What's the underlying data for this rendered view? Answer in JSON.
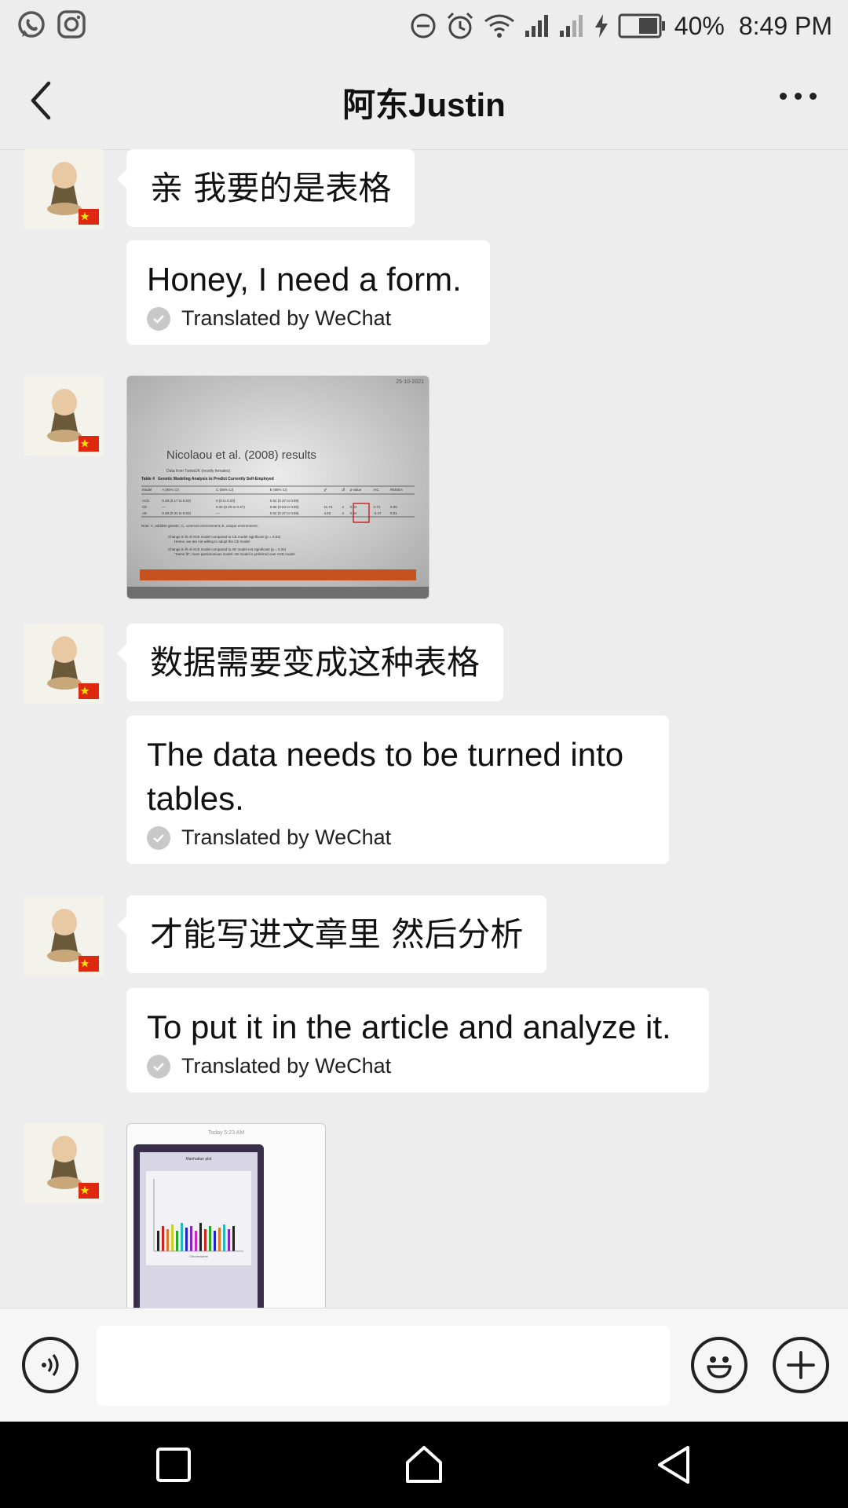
{
  "status_bar": {
    "battery_percent": "40%",
    "time": "8:49 PM",
    "left_icons": [
      "whatsapp-icon",
      "instagram-icon"
    ],
    "right_icons": [
      "dnd-icon",
      "alarm-icon",
      "wifi-icon",
      "signal-icon",
      "signal-icon",
      "charging-icon",
      "battery-icon"
    ]
  },
  "header": {
    "title": "阿东Justin",
    "back_icon": "chevron-left-icon",
    "more_icon": "more-icon"
  },
  "messages": [
    {
      "type": "text",
      "text": "亲 我要的是表格",
      "translation": "Honey, I need a form.",
      "translated_label": "Translated by WeChat"
    },
    {
      "type": "image",
      "image": {
        "date": "25-10-2021",
        "title": "Nicolaou et al. (2008) results",
        "subtitle": "Data from TwinsUK (mostly females)",
        "table_label": "Table 4",
        "table_caption": "Genetic Modeling Analysis to Predict Currently Self-Employed",
        "columns": [
          "Model",
          "A (95% CI)",
          "C (95% CI)",
          "E (95% CI)",
          "χ²",
          "df",
          "p-value",
          "AIC",
          "RMSEA"
        ],
        "rows": [
          [
            "ACE",
            "0.48 (0.17 to 0.63)",
            "0 (0 to 0.23)",
            "0.52 (0.37 to 0.68)",
            "",
            "",
            "",
            "",
            ""
          ],
          [
            "CE",
            "—",
            "0.34 (0.20 to 0.47)",
            "0.66 (0.53 to 0.80)",
            "11.74",
            "4",
            "0.02",
            "3.74",
            "0.05"
          ],
          [
            "AE",
            "0.48 (0.31 to 0.63)",
            "—",
            "0.52 (0.37 to 0.68)",
            "4.53",
            "4",
            "0.34",
            "-3.47",
            "0.01"
          ]
        ],
        "note": "Note. A, additive genetic; C, common environment; E, unique environment.",
        "points": [
          "Change in fit of ACE model compared to CE model significant (p = 0.02)",
          "Hence, we are not willing to adopt the CE model",
          "Change in fit of ACE model compared to AE model not significant (p = 0.34)",
          "\"Same fit\", more parsimonious model: AE model is preferred over ACE model"
        ]
      }
    },
    {
      "type": "text",
      "text": "数据需要变成这种表格",
      "translation": "The data needs to be turned into tables.",
      "translated_label": "Translated by WeChat"
    },
    {
      "type": "text",
      "text": "才能写进文章里 然后分析",
      "translation": "To put it in the article and analyze it.",
      "translated_label": "Translated by WeChat"
    },
    {
      "type": "image",
      "image": {
        "timestamp": "Today 5:23 AM",
        "plot_title": "Manhattan plot",
        "xlabel": "Chromosome"
      }
    }
  ],
  "input_bar": {
    "voice_icon": "voice-icon",
    "emoji_icon": "emoji-icon",
    "plus_icon": "plus-icon",
    "value": ""
  },
  "nav_bar": {
    "icons": [
      "recents-icon",
      "home-icon",
      "back-icon"
    ]
  },
  "colors": {
    "background": "#ededed",
    "bubble": "#ffffff",
    "flag_red": "#de2910",
    "flag_star": "#ffde00"
  }
}
